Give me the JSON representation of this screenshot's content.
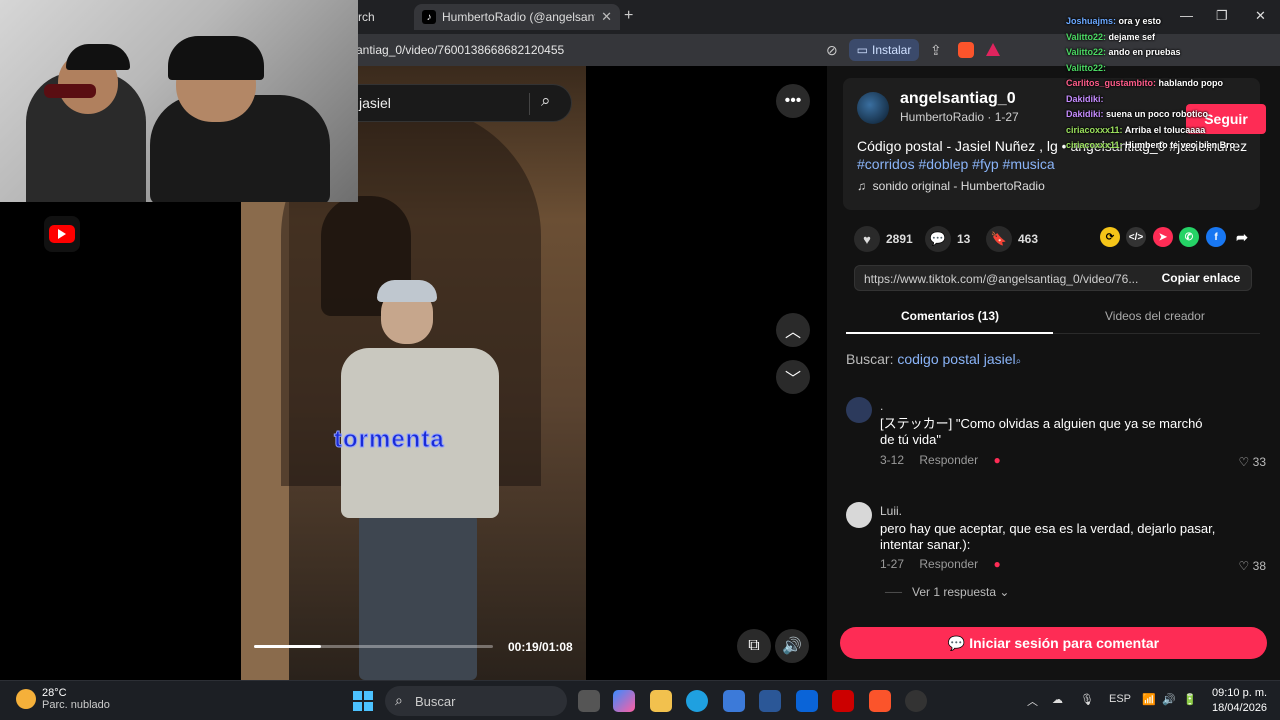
{
  "browser": {
    "tab_inactive_label": "rch",
    "tab_active_label": "HumbertoRadio (@angelsant",
    "url": "antiag_0/video/7600138668682120455",
    "install_label": "Instalar"
  },
  "video": {
    "search_query": "jasiel",
    "lyric_overlay": "tormenta",
    "progress_fraction": 0.28,
    "time": "00:19/01:08"
  },
  "post": {
    "author": "angelsantiag_0",
    "subtitle": "HumbertoRadio · 1-27",
    "description": "Código postal - Jasiel Nuñez , lg • angelsantiag_0 #jasielnunez",
    "hashtags": "#corridos #doblep #fyp #musica",
    "sound": "sonido original - HumbertoRadio",
    "follow_label": "Seguir"
  },
  "stats": {
    "likes": "2891",
    "comments": "13",
    "saves": "463"
  },
  "link": {
    "url": "https://www.tiktok.com/@angelsantiag_0/video/76...",
    "copy_label": "Copiar enlace"
  },
  "tabs": {
    "comments": "Comentarios (13)",
    "creator_videos": "Videos del creador"
  },
  "comment_search": {
    "label": "Buscar:",
    "term": "codigo postal jasiel"
  },
  "comments": [
    {
      "name": ".",
      "text": "[ステッカー] \"Como olvidas a alguien que ya se marchó de tú vida\"",
      "date": "3-12",
      "reply_label": "Responder",
      "likes": "33"
    },
    {
      "name": "Luii.",
      "text": "pero hay que aceptar, que esa es la verdad, dejarlo pasar, intentar sanar.):",
      "date": "1-27",
      "reply_label": "Responder",
      "likes": "38"
    }
  ],
  "view_replies": "Ver 1 respuesta",
  "login_label": "Iniciar sesión para comentar",
  "chat": [
    {
      "user": "Joshuajms:",
      "msg": "ora y esto",
      "color": "#6aa8ff"
    },
    {
      "user": "Valitto22:",
      "msg": "dejame sef",
      "color": "#4cd964"
    },
    {
      "user": "Valitto22:",
      "msg": "ando en pruebas",
      "color": "#4cd964"
    },
    {
      "user": "Valitto22:",
      "msg": "",
      "color": "#4cd964"
    },
    {
      "user": "Carlitos_gustambito:",
      "msg": "hablando popo",
      "color": "#ff5c8a"
    },
    {
      "user": "Dakidiki:",
      "msg": "",
      "color": "#c58cff"
    },
    {
      "user": "Dakidiki:",
      "msg": "suena un poco robotico",
      "color": "#c58cff"
    },
    {
      "user": "ciriacoxxx11:",
      "msg": "Arriba el tolucaaaa",
      "color": "#9be15d"
    },
    {
      "user": "ciriacoxxx11:",
      "msg": "Humberto te veo bien Bro",
      "color": "#9be15d"
    }
  ],
  "taskbar": {
    "temp": "28°C",
    "condition": "Parc. nublado",
    "weather_badge": "1",
    "search_label": "Buscar",
    "lang": "ESP",
    "time": "09:10 p. m.",
    "date": "18/04/2026"
  },
  "colors": {
    "accent": "#fe2c55",
    "link": "#8ab4f8"
  }
}
